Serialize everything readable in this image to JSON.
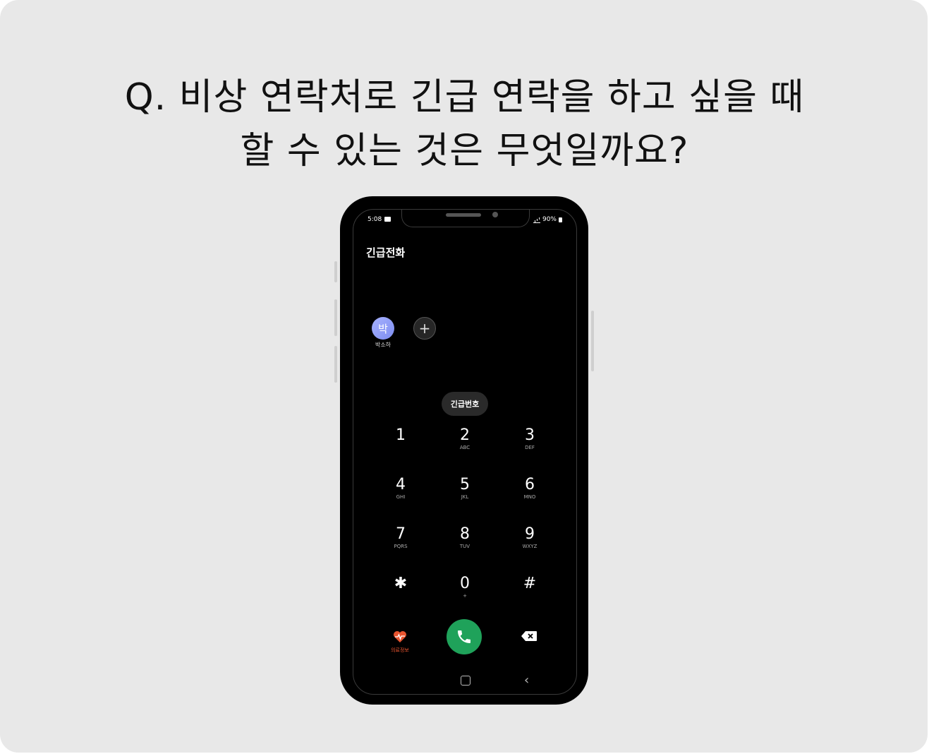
{
  "question": {
    "line1": "Q. 비상 연락처로 긴급 연락을 하고 싶을 때",
    "line2": "할 수 있는 것은 무엇일까요?"
  },
  "phone": {
    "status": {
      "time": "5:08",
      "battery": "90%"
    },
    "title": "긴급전화",
    "contact": {
      "initial": "박",
      "name": "박소하"
    },
    "add_symbol": "+",
    "emergency_button": "긴급번호",
    "keypad": [
      {
        "digit": "1",
        "letters": ""
      },
      {
        "digit": "2",
        "letters": "ABC"
      },
      {
        "digit": "3",
        "letters": "DEF"
      },
      {
        "digit": "4",
        "letters": "GHI"
      },
      {
        "digit": "5",
        "letters": "JKL"
      },
      {
        "digit": "6",
        "letters": "MNO"
      },
      {
        "digit": "7",
        "letters": "PQRS"
      },
      {
        "digit": "8",
        "letters": "TUV"
      },
      {
        "digit": "9",
        "letters": "WXYZ"
      },
      {
        "digit": "✱",
        "letters": ""
      },
      {
        "digit": "0",
        "letters": "+"
      },
      {
        "digit": "#",
        "letters": ""
      }
    ],
    "medical_label": "의료정보",
    "icons": {
      "heart": "heart-pulse-icon",
      "call": "phone-call-icon",
      "backspace": "backspace-icon",
      "home": "home-nav-icon",
      "back": "back-nav-icon"
    },
    "colors": {
      "call": "#1fa25a",
      "medical": "#e8542f",
      "avatar": "#8f9cf5"
    }
  }
}
